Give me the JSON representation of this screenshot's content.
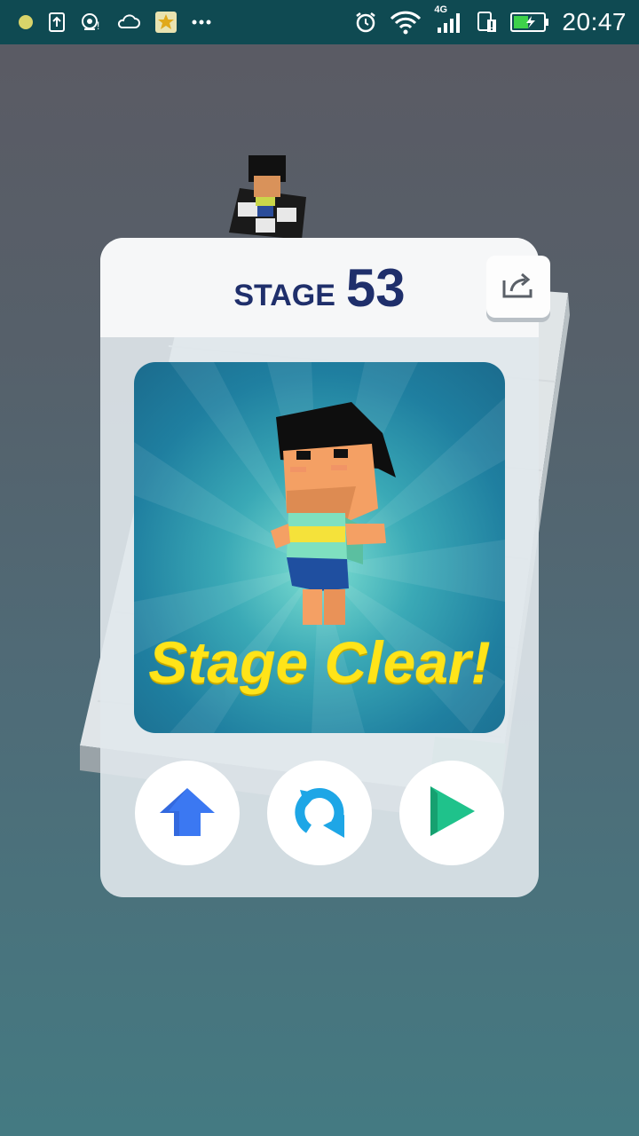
{
  "status_bar": {
    "time": "20:47",
    "network": "4G",
    "icons": [
      "dot-icon",
      "upload-icon",
      "hotspot-icon",
      "weather-icon",
      "app-star-icon",
      "more-icon",
      "alarm-icon",
      "wifi-icon",
      "signal-icon",
      "sim-alert-icon",
      "battery-icon"
    ]
  },
  "modal": {
    "stage_label": "STAGE",
    "stage_number": "53",
    "result_text": "Stage Clear!",
    "share_icon": "share-icon",
    "buttons": [
      {
        "icon": "home-arrow-icon",
        "color": "#3b78f2"
      },
      {
        "icon": "restart-icon",
        "color": "#1ea6e6"
      },
      {
        "icon": "play-next-icon",
        "color": "#1fc28b"
      }
    ]
  },
  "colors": {
    "status_bar": "#0f4a52",
    "title": "#1f2f6b",
    "clear_text": "#ffe419"
  }
}
